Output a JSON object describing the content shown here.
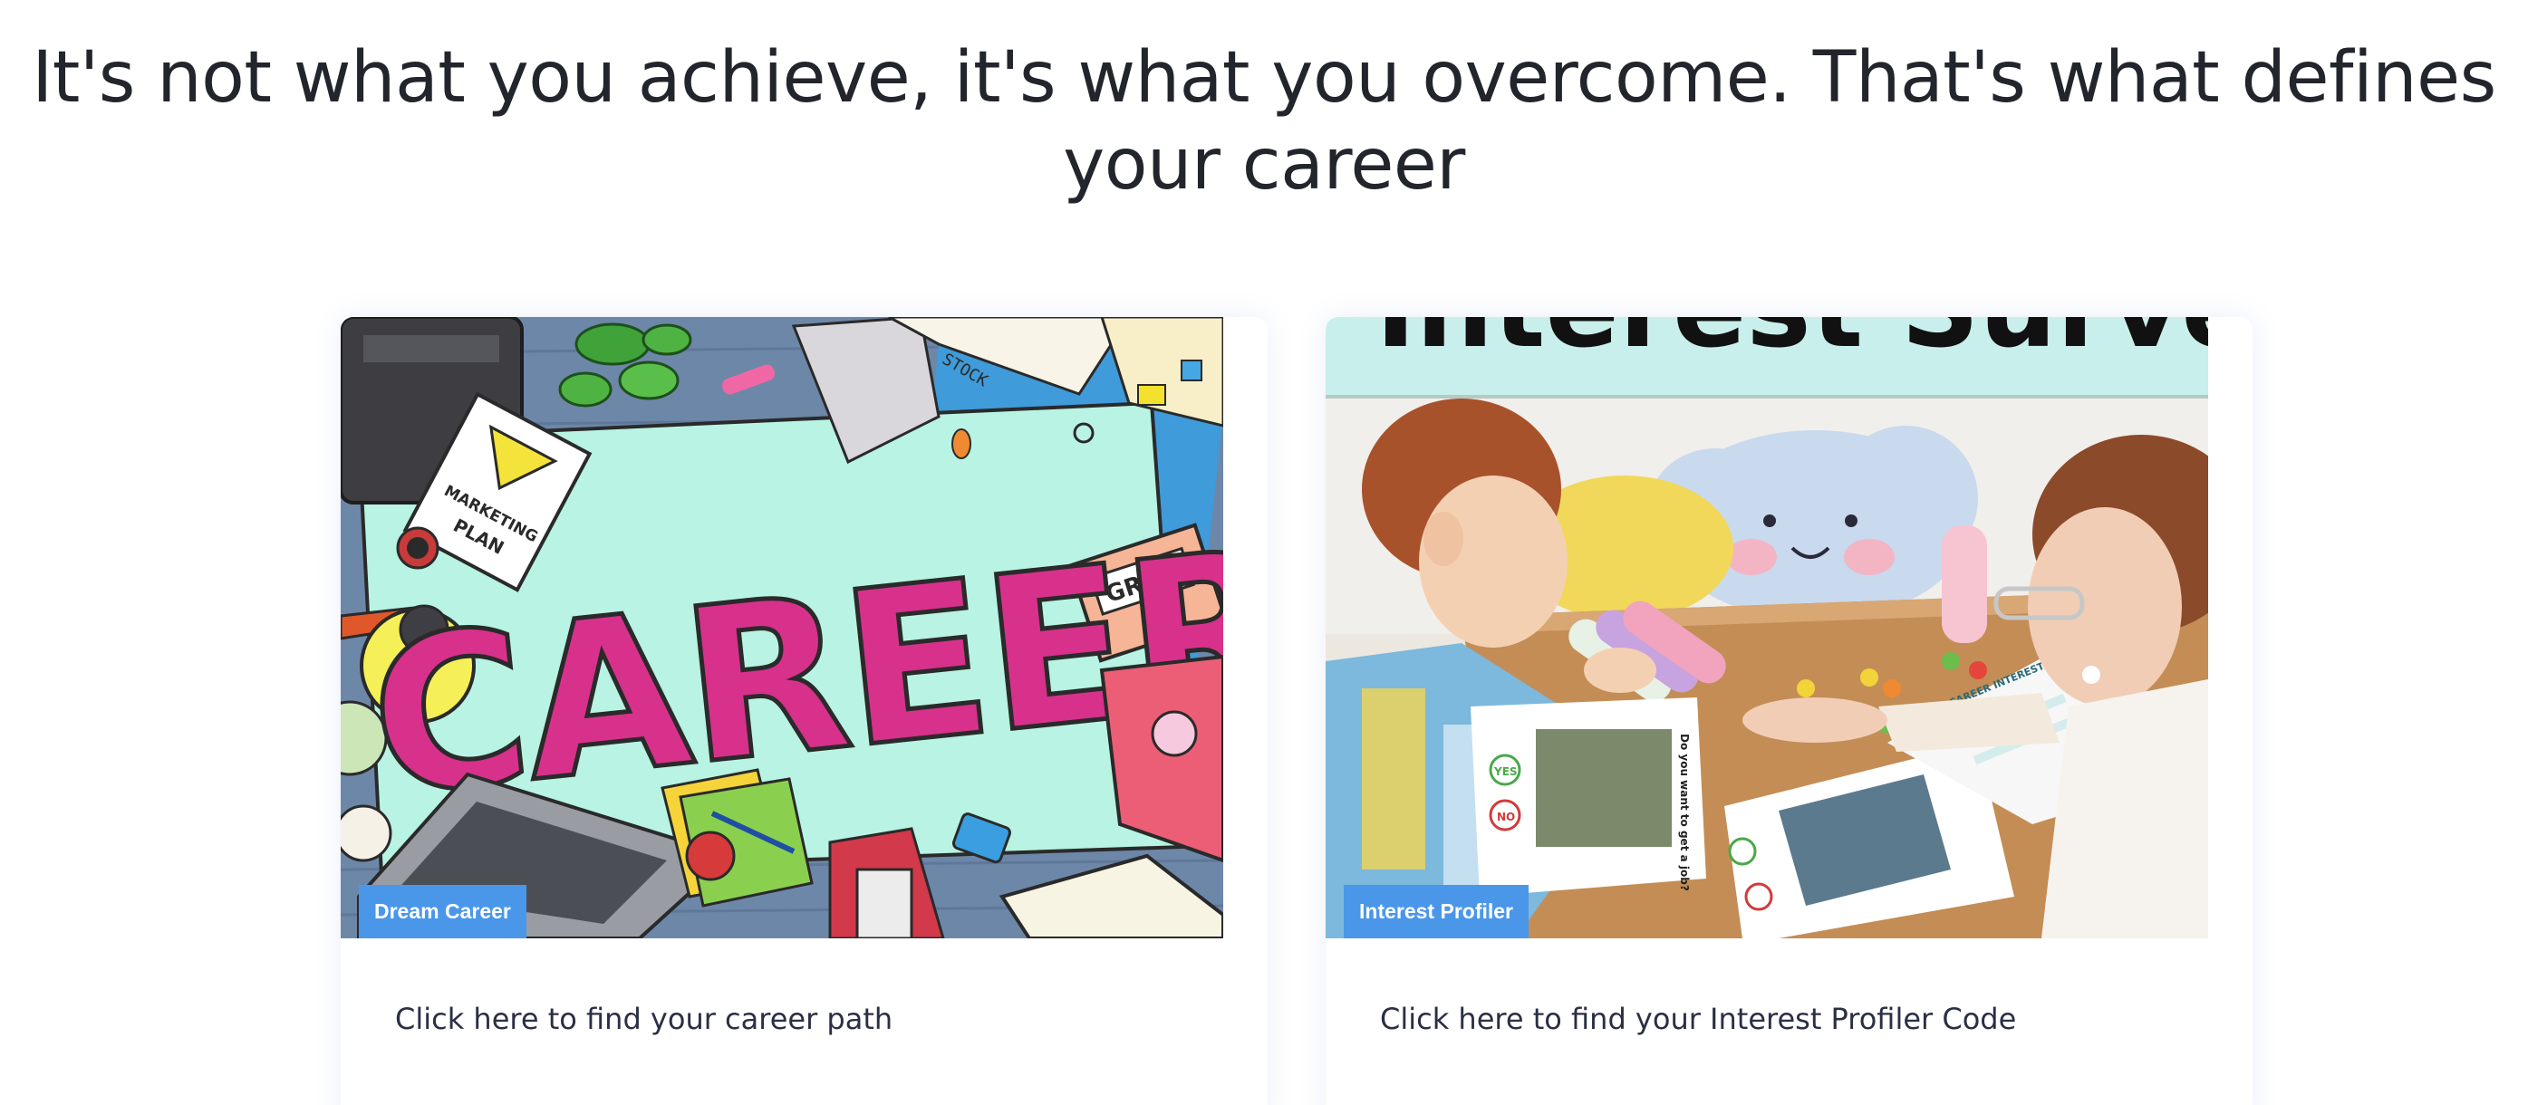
{
  "headline": "It's not what you achieve, it's what you overcome. That's what defines your career",
  "cards": [
    {
      "badge": "Dream Career",
      "link_text": "Click here to find your career path",
      "image_text": {
        "main": "CAREER",
        "plan_line1": "MARKETING",
        "plan_line2": "PLAN",
        "grow": "GROW",
        "stock": "STOCK"
      }
    },
    {
      "badge": "Interest Profiler",
      "link_text": "Click here to find your Interest Profiler Code",
      "image_text": {
        "banner": "Interest Survey",
        "card_yes": "YES",
        "card_no": "NO",
        "card_question": "Do you want to get a job?",
        "worksheet_title": "CAREER INTEREST SURVEY"
      }
    }
  ],
  "colors": {
    "badge": "#4a97ea",
    "career_pink": "#d8318c",
    "mint": "#b5f2e3",
    "banner_teal": "#c9efec"
  }
}
